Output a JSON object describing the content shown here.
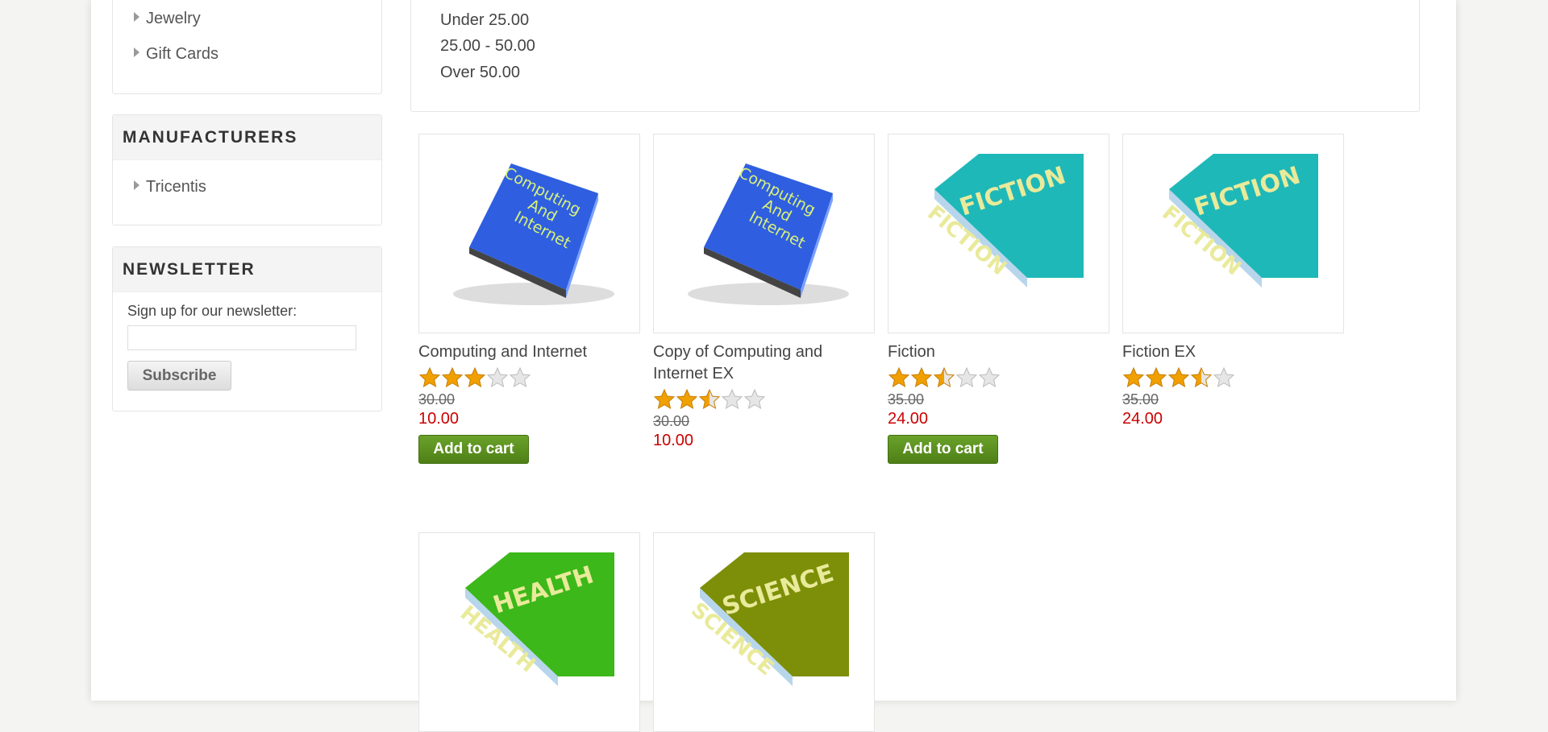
{
  "categories": {
    "items": [
      {
        "label": "Jewelry"
      },
      {
        "label": "Gift Cards"
      }
    ]
  },
  "manufacturers": {
    "title": "MANUFACTURERS",
    "items": [
      {
        "label": "Tricentis"
      }
    ]
  },
  "newsletter": {
    "title": "NEWSLETTER",
    "label": "Sign up for our newsletter:",
    "input_value": "",
    "subscribe_label": "Subscribe"
  },
  "price_filter": {
    "ranges": [
      "Under 25.00",
      "25.00 - 50.00",
      "Over 50.00"
    ]
  },
  "products": [
    {
      "title": "Computing and Internet",
      "rating": 3,
      "old_price": "30.00",
      "price": "10.00",
      "add_to_cart": "Add to cart",
      "cover_text": [
        "Computing",
        "And",
        "Internet"
      ],
      "cover_color": "#2f5fe0"
    },
    {
      "title": "Copy of Computing and Internet EX",
      "rating": 2.5,
      "old_price": "30.00",
      "price": "10.00",
      "add_to_cart": "",
      "cover_text": [
        "Computing",
        "And",
        "Internet"
      ],
      "cover_color": "#2f5fe0"
    },
    {
      "title": "Fiction",
      "rating": 2.5,
      "old_price": "35.00",
      "price": "24.00",
      "add_to_cart": "Add to cart",
      "cover_text": [
        "FICTION"
      ],
      "cover_color": "#1fb8b8"
    },
    {
      "title": "Fiction EX",
      "rating": 3.5,
      "old_price": "35.00",
      "price": "24.00",
      "add_to_cart": "",
      "cover_text": [
        "FICTION"
      ],
      "cover_color": "#1fb8b8"
    },
    {
      "title": "",
      "rating": 0,
      "old_price": "",
      "price": "",
      "add_to_cart": "",
      "cover_text": [
        "HEALTH"
      ],
      "cover_color": "#3cb81a"
    },
    {
      "title": "",
      "rating": 0,
      "old_price": "",
      "price": "",
      "add_to_cart": "",
      "cover_text": [
        "SCIENCE"
      ],
      "cover_color": "#7d8f08"
    }
  ],
  "colors": {
    "price_red": "#cc0000",
    "cart_green": "#5a8f1e",
    "star_gold": "#f0a000"
  }
}
